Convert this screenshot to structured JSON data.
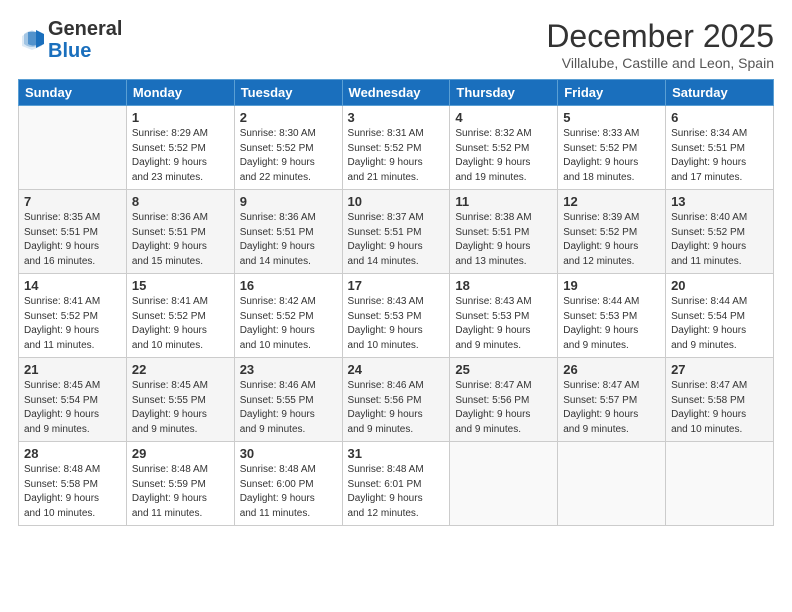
{
  "logo": {
    "text_general": "General",
    "text_blue": "Blue"
  },
  "header": {
    "month": "December 2025",
    "location": "Villalube, Castille and Leon, Spain"
  },
  "days_of_week": [
    "Sunday",
    "Monday",
    "Tuesday",
    "Wednesday",
    "Thursday",
    "Friday",
    "Saturday"
  ],
  "weeks": [
    [
      {
        "num": "",
        "info": ""
      },
      {
        "num": "1",
        "info": "Sunrise: 8:29 AM\nSunset: 5:52 PM\nDaylight: 9 hours\nand 23 minutes."
      },
      {
        "num": "2",
        "info": "Sunrise: 8:30 AM\nSunset: 5:52 PM\nDaylight: 9 hours\nand 22 minutes."
      },
      {
        "num": "3",
        "info": "Sunrise: 8:31 AM\nSunset: 5:52 PM\nDaylight: 9 hours\nand 21 minutes."
      },
      {
        "num": "4",
        "info": "Sunrise: 8:32 AM\nSunset: 5:52 PM\nDaylight: 9 hours\nand 19 minutes."
      },
      {
        "num": "5",
        "info": "Sunrise: 8:33 AM\nSunset: 5:52 PM\nDaylight: 9 hours\nand 18 minutes."
      },
      {
        "num": "6",
        "info": "Sunrise: 8:34 AM\nSunset: 5:51 PM\nDaylight: 9 hours\nand 17 minutes."
      }
    ],
    [
      {
        "num": "7",
        "info": "Sunrise: 8:35 AM\nSunset: 5:51 PM\nDaylight: 9 hours\nand 16 minutes."
      },
      {
        "num": "8",
        "info": "Sunrise: 8:36 AM\nSunset: 5:51 PM\nDaylight: 9 hours\nand 15 minutes."
      },
      {
        "num": "9",
        "info": "Sunrise: 8:36 AM\nSunset: 5:51 PM\nDaylight: 9 hours\nand 14 minutes."
      },
      {
        "num": "10",
        "info": "Sunrise: 8:37 AM\nSunset: 5:51 PM\nDaylight: 9 hours\nand 14 minutes."
      },
      {
        "num": "11",
        "info": "Sunrise: 8:38 AM\nSunset: 5:51 PM\nDaylight: 9 hours\nand 13 minutes."
      },
      {
        "num": "12",
        "info": "Sunrise: 8:39 AM\nSunset: 5:52 PM\nDaylight: 9 hours\nand 12 minutes."
      },
      {
        "num": "13",
        "info": "Sunrise: 8:40 AM\nSunset: 5:52 PM\nDaylight: 9 hours\nand 11 minutes."
      }
    ],
    [
      {
        "num": "14",
        "info": "Sunrise: 8:41 AM\nSunset: 5:52 PM\nDaylight: 9 hours\nand 11 minutes."
      },
      {
        "num": "15",
        "info": "Sunrise: 8:41 AM\nSunset: 5:52 PM\nDaylight: 9 hours\nand 10 minutes."
      },
      {
        "num": "16",
        "info": "Sunrise: 8:42 AM\nSunset: 5:52 PM\nDaylight: 9 hours\nand 10 minutes."
      },
      {
        "num": "17",
        "info": "Sunrise: 8:43 AM\nSunset: 5:53 PM\nDaylight: 9 hours\nand 10 minutes."
      },
      {
        "num": "18",
        "info": "Sunrise: 8:43 AM\nSunset: 5:53 PM\nDaylight: 9 hours\nand 9 minutes."
      },
      {
        "num": "19",
        "info": "Sunrise: 8:44 AM\nSunset: 5:53 PM\nDaylight: 9 hours\nand 9 minutes."
      },
      {
        "num": "20",
        "info": "Sunrise: 8:44 AM\nSunset: 5:54 PM\nDaylight: 9 hours\nand 9 minutes."
      }
    ],
    [
      {
        "num": "21",
        "info": "Sunrise: 8:45 AM\nSunset: 5:54 PM\nDaylight: 9 hours\nand 9 minutes."
      },
      {
        "num": "22",
        "info": "Sunrise: 8:45 AM\nSunset: 5:55 PM\nDaylight: 9 hours\nand 9 minutes."
      },
      {
        "num": "23",
        "info": "Sunrise: 8:46 AM\nSunset: 5:55 PM\nDaylight: 9 hours\nand 9 minutes."
      },
      {
        "num": "24",
        "info": "Sunrise: 8:46 AM\nSunset: 5:56 PM\nDaylight: 9 hours\nand 9 minutes."
      },
      {
        "num": "25",
        "info": "Sunrise: 8:47 AM\nSunset: 5:56 PM\nDaylight: 9 hours\nand 9 minutes."
      },
      {
        "num": "26",
        "info": "Sunrise: 8:47 AM\nSunset: 5:57 PM\nDaylight: 9 hours\nand 9 minutes."
      },
      {
        "num": "27",
        "info": "Sunrise: 8:47 AM\nSunset: 5:58 PM\nDaylight: 9 hours\nand 10 minutes."
      }
    ],
    [
      {
        "num": "28",
        "info": "Sunrise: 8:48 AM\nSunset: 5:58 PM\nDaylight: 9 hours\nand 10 minutes."
      },
      {
        "num": "29",
        "info": "Sunrise: 8:48 AM\nSunset: 5:59 PM\nDaylight: 9 hours\nand 11 minutes."
      },
      {
        "num": "30",
        "info": "Sunrise: 8:48 AM\nSunset: 6:00 PM\nDaylight: 9 hours\nand 11 minutes."
      },
      {
        "num": "31",
        "info": "Sunrise: 8:48 AM\nSunset: 6:01 PM\nDaylight: 9 hours\nand 12 minutes."
      },
      {
        "num": "",
        "info": ""
      },
      {
        "num": "",
        "info": ""
      },
      {
        "num": "",
        "info": ""
      }
    ]
  ]
}
